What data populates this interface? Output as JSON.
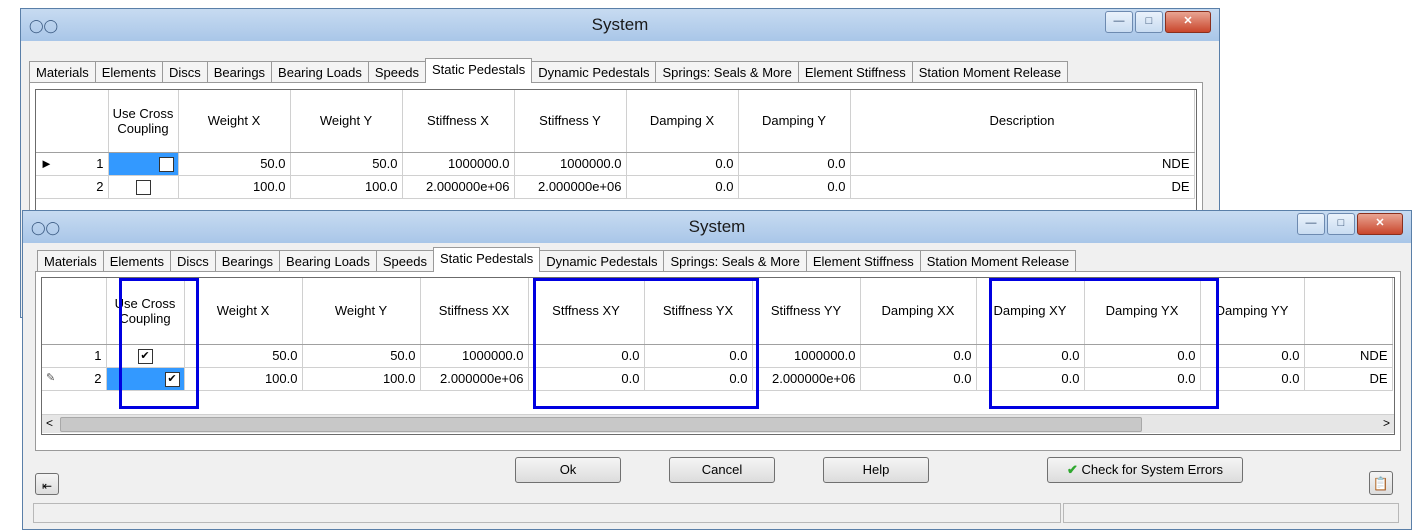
{
  "back_window": {
    "title": "System",
    "tabs": [
      "Materials",
      "Elements",
      "Discs",
      "Bearings",
      "Bearing Loads",
      "Speeds",
      "Static Pedestals",
      "Dynamic Pedestals",
      "Springs: Seals & More",
      "Element Stiffness",
      "Station Moment Release"
    ],
    "active_tab": "Static Pedestals",
    "columns": [
      "",
      "Use Cross Coupling",
      "Weight X",
      "Weight Y",
      "Stiffness X",
      "Stiffness Y",
      "Damping X",
      "Damping Y",
      "Description"
    ],
    "rows": [
      {
        "num": "1",
        "weight_x": "50.0",
        "weight_y": "50.0",
        "stiffness_x": "1000000.0",
        "stiffness_y": "1000000.0",
        "damping_x": "0.0",
        "damping_y": "0.0",
        "description": "NDE"
      },
      {
        "num": "2",
        "weight_x": "100.0",
        "weight_y": "100.0",
        "stiffness_x": "2.000000e+06",
        "stiffness_y": "2.000000e+06",
        "damping_x": "0.0",
        "damping_y": "0.0",
        "description": "DE"
      }
    ]
  },
  "front_window": {
    "title": "System",
    "tabs": [
      "Materials",
      "Elements",
      "Discs",
      "Bearings",
      "Bearing Loads",
      "Speeds",
      "Static Pedestals",
      "Dynamic Pedestals",
      "Springs: Seals & More",
      "Element Stiffness",
      "Station Moment Release"
    ],
    "active_tab": "Static Pedestals",
    "columns": [
      "",
      "Use Cross Coupling",
      "Weight X",
      "Weight Y",
      "Stiffness XX",
      "Stffness XY",
      "Stiffness YX",
      "Stiffness YY",
      "Damping XX",
      "Damping XY",
      "Damping YX",
      "Damping YY",
      ""
    ],
    "rows": [
      {
        "num": "1",
        "checked": true,
        "weight_x": "50.0",
        "weight_y": "50.0",
        "stiffness_xx": "1000000.0",
        "stiffness_xy": "0.0",
        "stiffness_yx": "0.0",
        "stiffness_yy": "1000000.0",
        "damping_xx": "0.0",
        "damping_xy": "0.0",
        "damping_yx": "0.0",
        "damping_yy": "0.0",
        "description": "NDE"
      },
      {
        "num": "2",
        "checked": true,
        "weight_x": "100.0",
        "weight_y": "100.0",
        "stiffness_xx": "2.000000e+06",
        "stiffness_xy": "0.0",
        "stiffness_yx": "0.0",
        "stiffness_yy": "2.000000e+06",
        "damping_xx": "0.0",
        "damping_xy": "0.0",
        "damping_yx": "0.0",
        "damping_yy": "0.0",
        "description": "DE"
      }
    ],
    "buttons": {
      "ok": "Ok",
      "cancel": "Cancel",
      "help": "Help",
      "check": "Check for System Errors"
    },
    "icons": {
      "window_icon": "app-icon",
      "pin": "pin-icon",
      "clipboard": "clipboard-icon",
      "check": "checkmark-icon"
    }
  },
  "colors": {
    "highlight_box": "#0000e0",
    "selected_cell": "#3399ff",
    "check_green": "#2fa82f"
  }
}
